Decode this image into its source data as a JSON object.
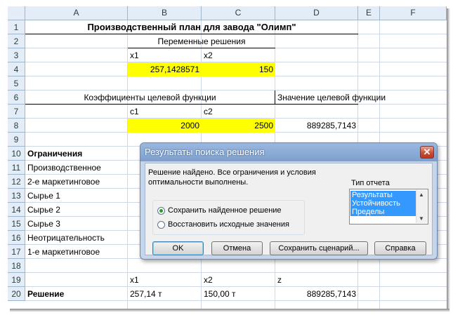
{
  "columns": [
    "A",
    "B",
    "C",
    "D",
    "E",
    "F"
  ],
  "rows": [
    "1",
    "2",
    "3",
    "4",
    "5",
    "6",
    "7",
    "8",
    "9",
    "10",
    "11",
    "12",
    "13",
    "14",
    "15",
    "16",
    "17",
    "18",
    "19",
    "20"
  ],
  "sheet": {
    "title": "Производственный план для завода \"Олимп\"",
    "var_heading": "Переменные решения",
    "x1_label": "x1",
    "x2_label": "x2",
    "x1_value": "257,1428571",
    "x2_value": "150",
    "coef_heading": "Коэффициенты целевой функции",
    "objective_heading": "Значение целевой функции",
    "c1_label": "c1",
    "c2_label": "c2",
    "c1_value": "2000",
    "c2_value": "2500",
    "objective_value": "889285,7143",
    "constraints_heading": "Ограничения",
    "constraints": [
      "Производственное",
      "2-е маркетинговое",
      "Сырье 1",
      "Сырье 2",
      "Сырье 3",
      "Неотрицательность",
      "1-е маркетинговое"
    ],
    "row19": {
      "b": "x1",
      "c": "x2",
      "d": "z"
    },
    "row20": {
      "a": "Решение",
      "b": "257,14 т",
      "c": "150,00 т",
      "d": "889285,7143"
    }
  },
  "dialog": {
    "title": "Результаты поиска решения",
    "message": "Решение найдено. Все ограничения и условия оптимальности выполнены.",
    "report_type_label": "Тип отчета",
    "reports": [
      "Результаты",
      "Устойчивость",
      "Пределы"
    ],
    "option_keep": "Сохранить найденное решение",
    "option_restore": "Восстановить исходные значения",
    "buttons": {
      "ok": "OK",
      "cancel": "Отмена",
      "save_scenario": "Сохранить сценарий...",
      "help": "Справка"
    },
    "close_glyph": "✕"
  }
}
